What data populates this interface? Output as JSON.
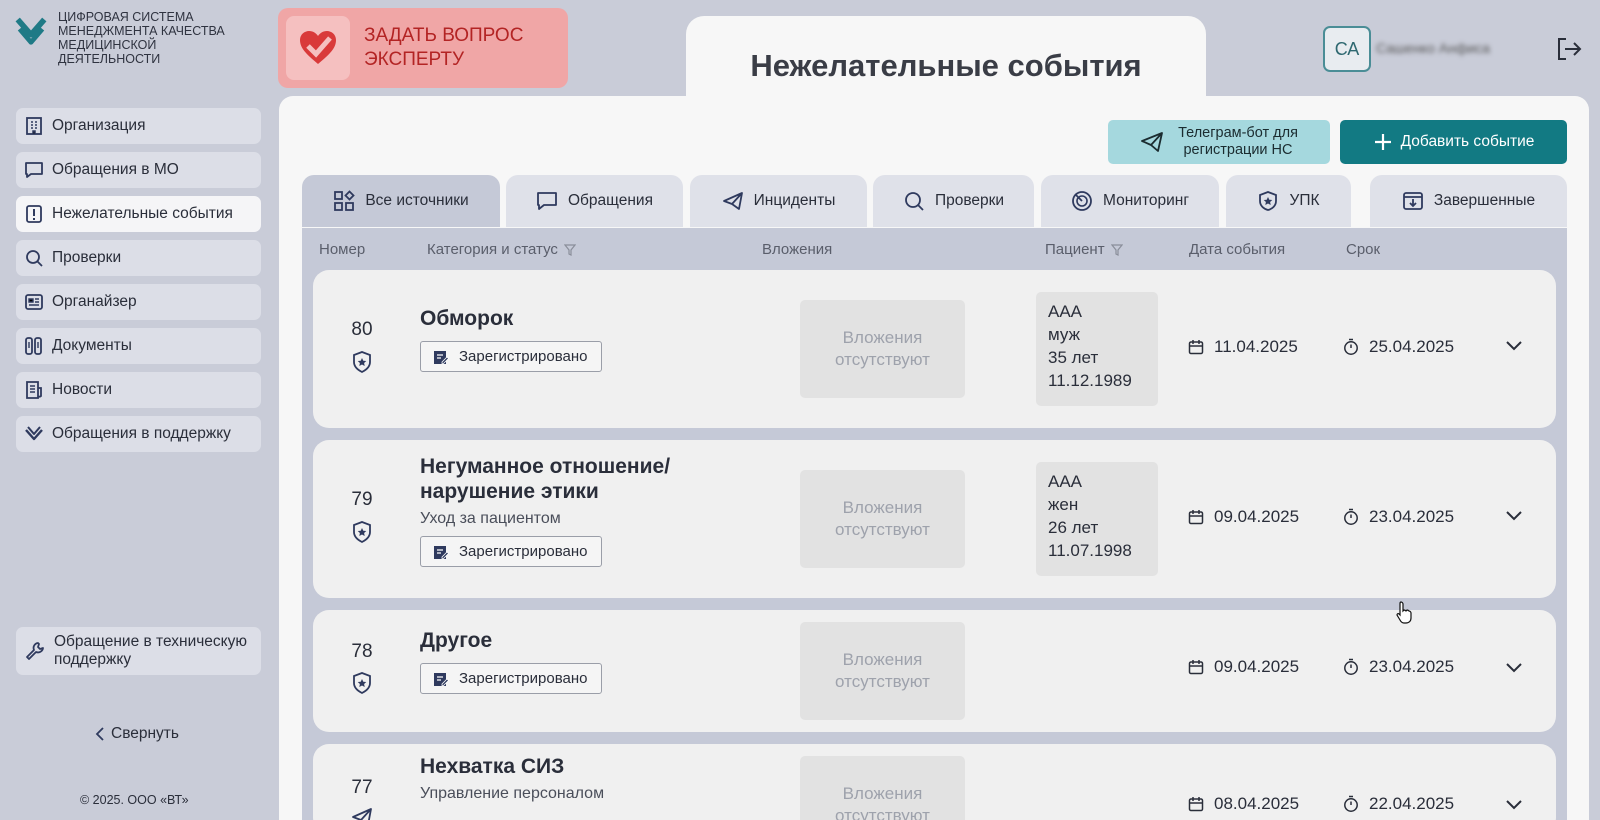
{
  "logo": {
    "line1": "ЦИФРОВАЯ СИСТЕМА",
    "line2": "МЕНЕДЖМЕНТА КАЧЕСТВА",
    "line3": "МЕДИЦИНСКОЙ",
    "line4": "ДЕЯТЕЛЬНОСТИ"
  },
  "ask_expert": {
    "line1": "ЗАДАТЬ ВОПРОС",
    "line2": "ЭКСПЕРТУ"
  },
  "sidebar": {
    "items": [
      {
        "label": "Организация",
        "icon": "building-icon"
      },
      {
        "label": "Обращения в МО",
        "icon": "chat-icon"
      },
      {
        "label": "Нежелательные события",
        "icon": "alert-icon",
        "active": true
      },
      {
        "label": "Проверки",
        "icon": "search-icon"
      },
      {
        "label": "Органайзер",
        "icon": "organizer-icon"
      },
      {
        "label": "Документы",
        "icon": "documents-icon"
      },
      {
        "label": "Новости",
        "icon": "news-icon"
      },
      {
        "label": "Обращения в поддержку",
        "icon": "support-check-icon"
      }
    ],
    "tech_support": {
      "line1": "Обращение в техническую",
      "line2": "поддержку"
    },
    "collapse": "Свернуть",
    "copyright": "© 2025. ООО «ВТ»"
  },
  "header": {
    "title": "Нежелательные события",
    "avatar": "СА",
    "user_name": "Сашенко Анфиса"
  },
  "toolbar": {
    "telegram_line1": "Телеграм-бот для",
    "telegram_line2": "регистрации НС",
    "add_event": "Добавить событие"
  },
  "tabs": [
    {
      "label": "Все источники",
      "active": true
    },
    {
      "label": "Обращения"
    },
    {
      "label": "Инциденты"
    },
    {
      "label": "Проверки"
    },
    {
      "label": "Мониторинг"
    },
    {
      "label": "УПК"
    },
    {
      "label": "Завершенные"
    }
  ],
  "table": {
    "headers": {
      "number": "Номер",
      "category": "Категория и статус",
      "attachments": "Вложения",
      "patient": "Пациент",
      "event_date": "Дата события",
      "deadline": "Срок"
    },
    "no_attachments_line1": "Вложения",
    "no_attachments_line2": "отсутствуют",
    "rows": [
      {
        "number": "80",
        "title_line1": "Обморок",
        "title_line2": "",
        "subtitle": "",
        "status": "Зарегистрировано",
        "source_icon": "upk-shield-icon",
        "patient": {
          "name": "ААА",
          "sex": "муж",
          "age": "35 лет",
          "dob": "11.12.1989"
        },
        "event_date": "11.04.2025",
        "deadline": "25.04.2025"
      },
      {
        "number": "79",
        "title_line1": "Негуманное отношение/",
        "title_line2": "нарушение этики",
        "subtitle": "Уход за пациентом",
        "status": "Зарегистрировано",
        "source_icon": "upk-shield-icon",
        "patient": {
          "name": "ААА",
          "sex": "жен",
          "age": "26 лет",
          "dob": "11.07.1998"
        },
        "event_date": "09.04.2025",
        "deadline": "23.04.2025"
      },
      {
        "number": "78",
        "title_line1": "Другое",
        "title_line2": "",
        "subtitle": "",
        "status": "Зарегистрировано",
        "source_icon": "upk-shield-icon",
        "event_date": "09.04.2025",
        "deadline": "23.04.2025"
      },
      {
        "number": "77",
        "title_line1": "Нехватка СИЗ",
        "title_line2": "",
        "subtitle": "Управление персоналом",
        "status": "",
        "source_icon": "telegram-icon",
        "event_date": "08.04.2025",
        "deadline": "22.04.2025"
      }
    ]
  },
  "colors": {
    "accent": "#127a83",
    "telegram_btn": "#a5d8de",
    "ask_expert_bg": "#f0a6a6",
    "ask_expert_text": "#b32424",
    "icon_navy": "#2f3a5e"
  }
}
